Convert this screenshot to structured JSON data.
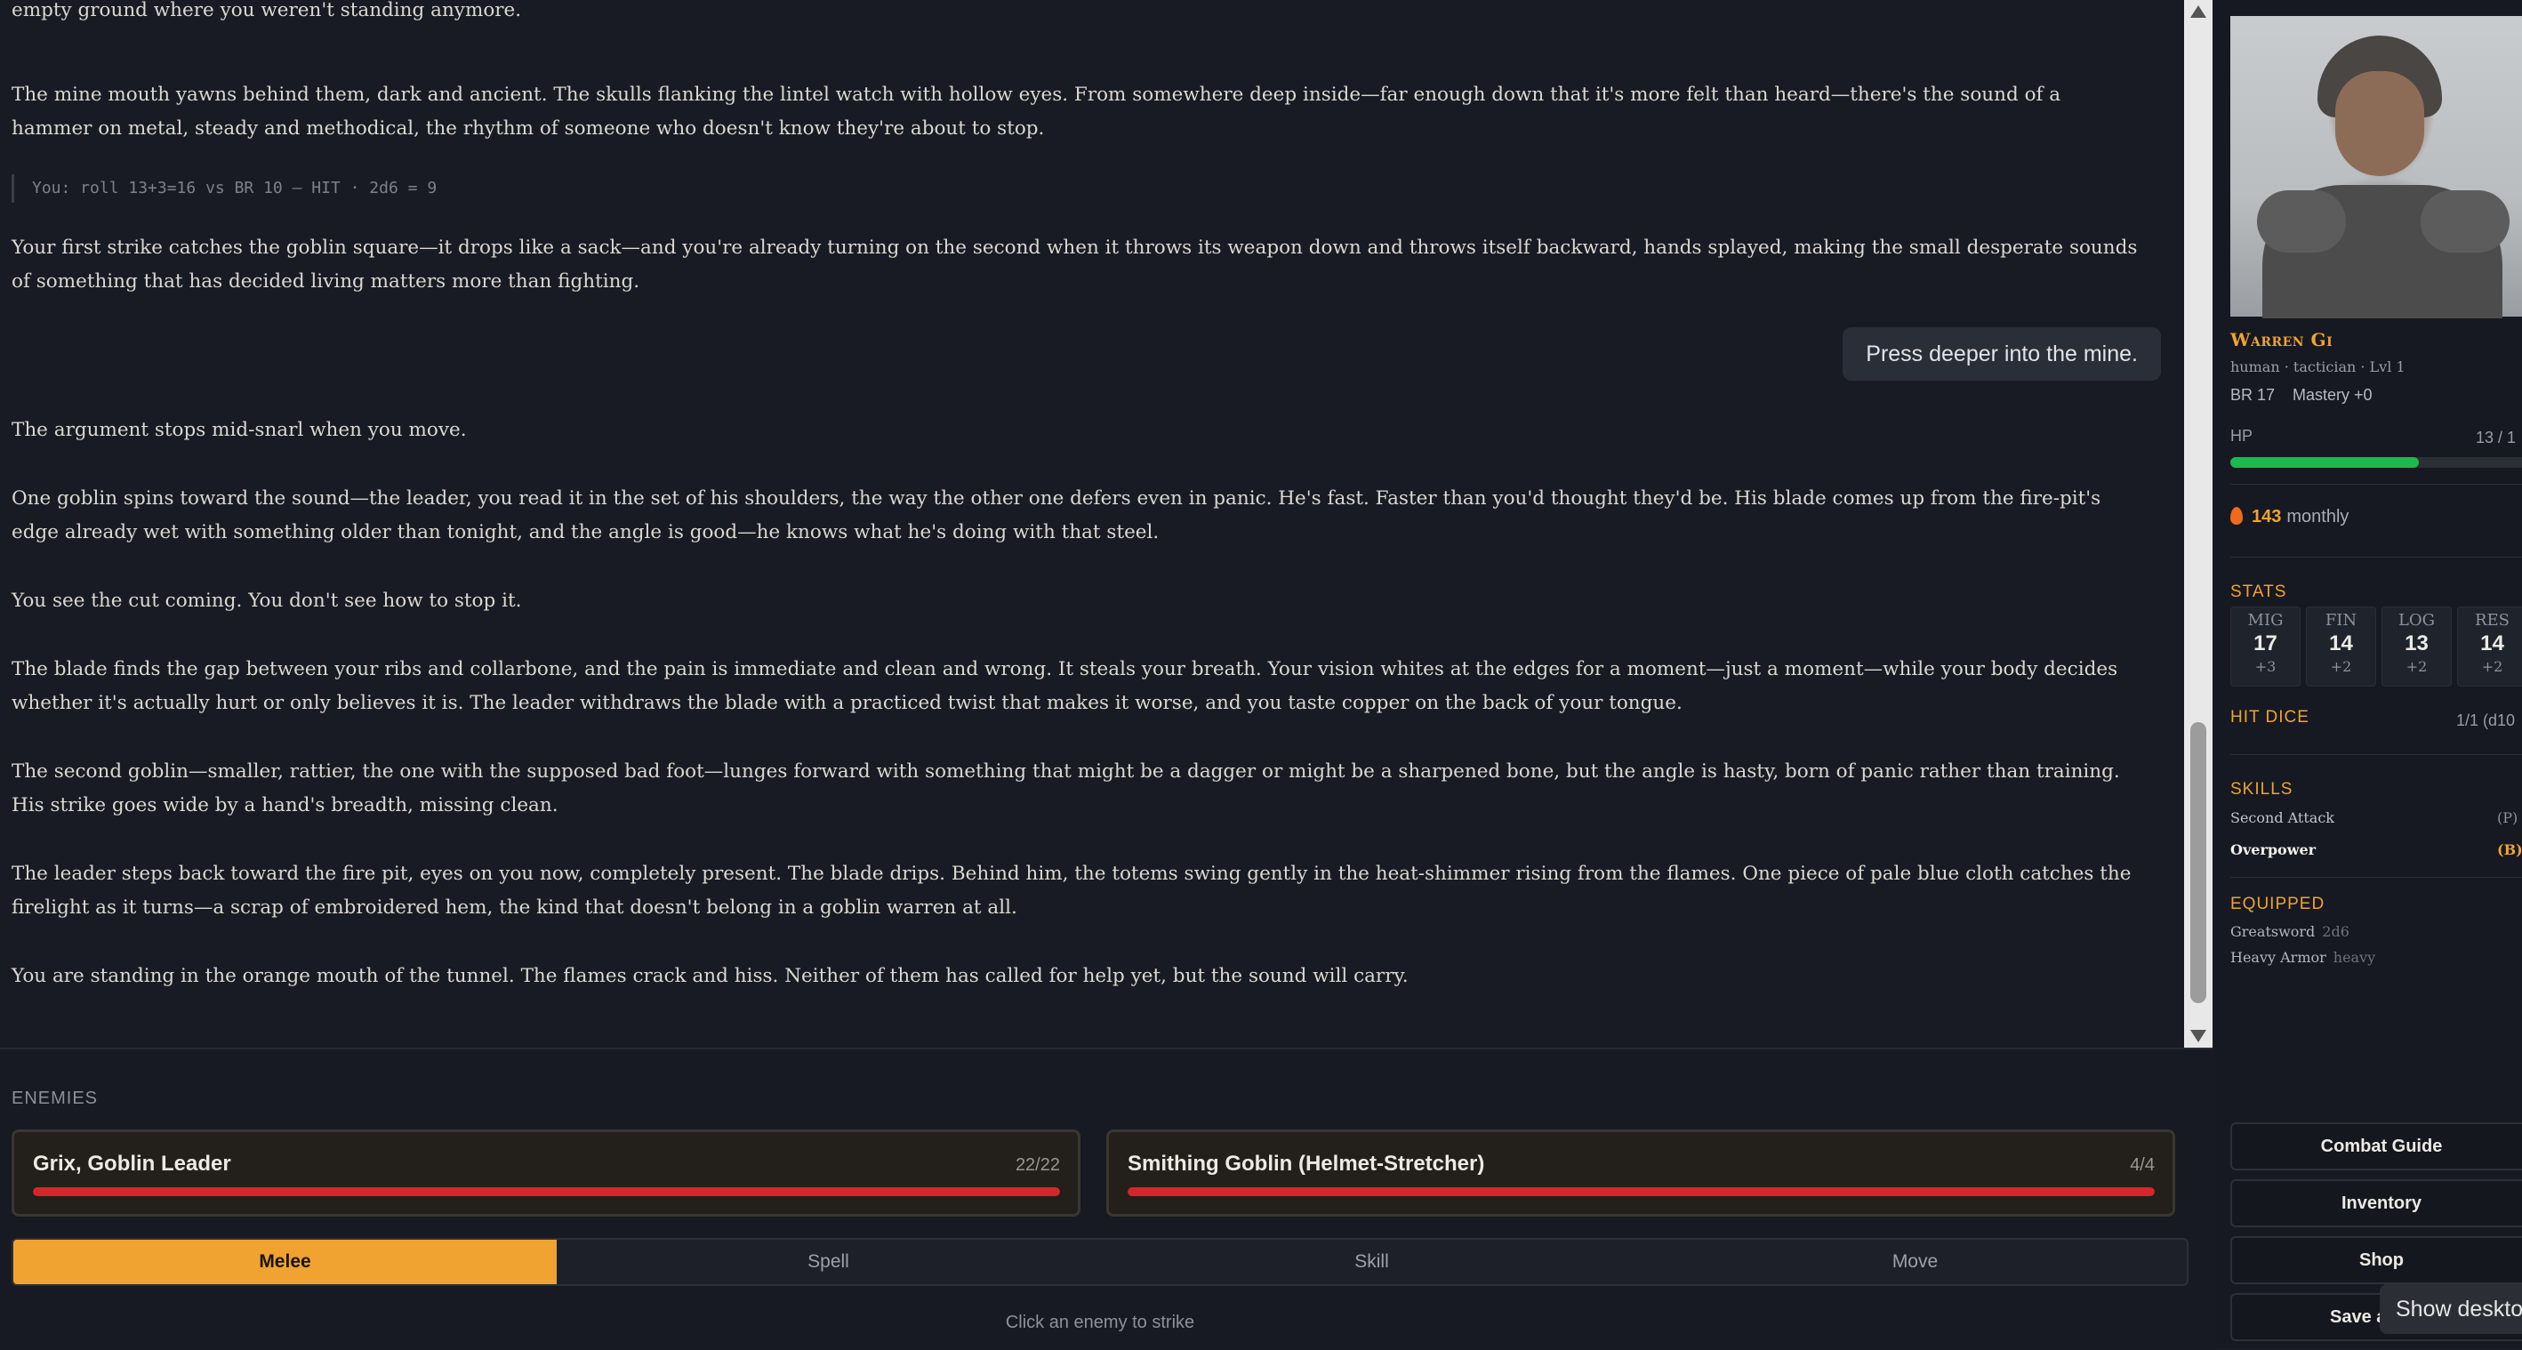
{
  "story": {
    "paragraphs": [
      "empty ground where you weren't standing anymore.",
      "The mine mouth yawns behind them, dark and ancient. The skulls flanking the lintel watch with hollow eyes. From somewhere deep inside—far enough down that it's more felt than heard—there's the sound of a hammer on metal, steady and methodical, the rhythm of someone who doesn't know they're about to stop.",
      "Your first strike catches the goblin square—it drops like a sack—and you're already turning on the second when it throws its weapon down and throws itself backward, hands splayed, making the small desperate sounds of something that has decided living matters more than fighting.",
      "The argument stops mid-snarl when you move.",
      "One goblin spins toward the sound—the leader, you read it in the set of his shoulders, the way the other one defers even in panic. He's fast. Faster than you'd thought they'd be. His blade comes up from the fire-pit's edge already wet with something older than tonight, and the angle is good—he knows what he's doing with that steel.",
      "You see the cut coming. You don't see how to stop it.",
      "The blade finds the gap between your ribs and collarbone, and the pain is immediate and clean and wrong. It steals your breath. Your vision whites at the edges for a moment—just a moment—while your body decides whether it's actually hurt or only believes it is. The leader withdraws the blade with a practiced twist that makes it worse, and you taste copper on the back of your tongue.",
      "The second goblin—smaller, rattier, the one with the supposed bad foot—lunges forward with something that might be a dagger or might be a sharpened bone, but the angle is hasty, born of panic rather than training. His strike goes wide by a hand's breadth, missing clean.",
      "The leader steps back toward the fire pit, eyes on you now, completely present. The blade drips. Behind him, the totems swing gently in the heat-shimmer rising from the flames. One piece of pale blue cloth catches the firelight as it turns—a scrap of embroidered hem, the kind that doesn't belong in a goblin warren at all.",
      "You are standing in the orange mouth of the tunnel. The flames crack and hiss. Neither of them has called for help yet, but the sound will carry."
    ],
    "roll_line": "You: roll 13+3=16 vs BR 10 — HIT · 2d6 = 9",
    "player_message": "Press deeper into the mine."
  },
  "enemies": {
    "label": "ENEMIES",
    "list": [
      {
        "name": "Grix, Goblin Leader",
        "hp_text": "22/22",
        "hp_fraction": 1.0,
        "bar_color": "#d6262a"
      },
      {
        "name": "Smithing Goblin (Helmet-Stretcher)",
        "hp_text": "4/4",
        "hp_fraction": 1.0,
        "bar_color": "#d6262a"
      }
    ]
  },
  "actions": {
    "tabs": [
      "Melee",
      "Spell",
      "Skill",
      "Move"
    ],
    "active": "Melee",
    "hint": "Click an enemy to strike"
  },
  "character": {
    "name": "Warren Gi",
    "subtitle": "human · tactician · Lvl 1",
    "br_line": "BR 17    Mastery +0",
    "hp_label": "HP",
    "hp_text": "13 / 1",
    "hp_fraction": 0.59,
    "streak_value": "143",
    "streak_label": "monthly",
    "stats_title": "STATS",
    "stats": [
      {
        "abbr": "MIG",
        "score": "17",
        "mod": "+3"
      },
      {
        "abbr": "FIN",
        "score": "14",
        "mod": "+2"
      },
      {
        "abbr": "LOG",
        "score": "13",
        "mod": "+2"
      },
      {
        "abbr": "RES",
        "score": "14",
        "mod": "+2"
      }
    ],
    "hit_dice_title": "HIT DICE",
    "hit_dice_value": "1/1 (d10",
    "skills_title": "SKILLS",
    "skills": [
      {
        "name": "Second Attack",
        "tag": "(P)"
      },
      {
        "name": "Overpower",
        "tag": "(B)"
      }
    ],
    "equipped_title": "EQUIPPED",
    "equipped": [
      {
        "name": "Greatsword",
        "note": "2d6"
      },
      {
        "name": "Heavy Armor",
        "note": "heavy"
      }
    ]
  },
  "sidebar_buttons": {
    "combat_guide": "Combat Guide",
    "inventory": "Inventory",
    "shop": "Shop",
    "save": "Save a"
  },
  "tooltip": "Show desktop",
  "colors": {
    "accent": "#f0a330",
    "hp_green": "#1fb84d",
    "enemy_red": "#d6262a",
    "background": "#181b24"
  }
}
